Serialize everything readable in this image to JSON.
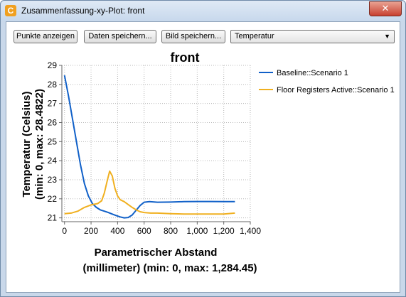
{
  "window": {
    "title": "Zusammenfassung-xy-Plot: front",
    "app_icon_glyph": "C",
    "close_glyph": "✕"
  },
  "toolbar": {
    "show_points_label": "Punkte anzeigen",
    "save_data_label": "Daten speichern...",
    "save_image_label": "Bild speichern...",
    "variable_select": {
      "selected": "Temperatur",
      "arrow_glyph": "▼"
    }
  },
  "chart_data": {
    "type": "line",
    "title": "front",
    "xlabel_line1": "Parametrischer Abstand",
    "xlabel_line2": "(millimeter) (min: 0, max: 1,284.45)",
    "ylabel_line1": "Temperatur (Celsius)",
    "ylabel_line2": "(min: 0, max: 28.4822)",
    "xlim": [
      -20,
      1400
    ],
    "ylim": [
      20.8,
      29
    ],
    "xticks": [
      0,
      200,
      400,
      600,
      800,
      1000,
      1200,
      1400
    ],
    "xtick_labels": [
      "0",
      "200",
      "400",
      "600",
      "800",
      "1,000",
      "1,200",
      "1,400"
    ],
    "yticks": [
      21,
      22,
      23,
      24,
      25,
      26,
      27,
      28,
      29
    ],
    "ytick_labels": [
      "21",
      "22",
      "23",
      "24",
      "25",
      "26",
      "27",
      "28",
      "29"
    ],
    "grid": true,
    "legend_position": "right",
    "series": [
      {
        "name": "Baseline::Scenario 1",
        "color": "#1060c8",
        "x": [
          0,
          30,
          60,
          90,
          120,
          150,
          180,
          210,
          240,
          270,
          300,
          330,
          360,
          390,
          420,
          450,
          480,
          510,
          540,
          570,
          600,
          640,
          700,
          800,
          900,
          1000,
          1100,
          1200,
          1284
        ],
        "y": [
          28.48,
          27.4,
          26.2,
          25.0,
          23.8,
          22.8,
          22.15,
          21.75,
          21.55,
          21.42,
          21.35,
          21.28,
          21.2,
          21.12,
          21.05,
          21.0,
          21.02,
          21.15,
          21.4,
          21.65,
          21.82,
          21.85,
          21.82,
          21.83,
          21.85,
          21.86,
          21.86,
          21.85,
          21.85
        ]
      },
      {
        "name": "Floor Registers Active::Scenario 1",
        "color": "#f0b020",
        "x": [
          0,
          50,
          100,
          150,
          200,
          250,
          280,
          300,
          320,
          340,
          360,
          380,
          400,
          420,
          450,
          480,
          510,
          540,
          570,
          600,
          650,
          700,
          800,
          900,
          1000,
          1100,
          1200,
          1284
        ],
        "y": [
          21.22,
          21.25,
          21.35,
          21.55,
          21.68,
          21.75,
          21.9,
          22.3,
          22.9,
          23.45,
          23.2,
          22.55,
          22.15,
          21.95,
          21.85,
          21.7,
          21.55,
          21.42,
          21.32,
          21.28,
          21.25,
          21.25,
          21.22,
          21.2,
          21.2,
          21.2,
          21.2,
          21.25
        ]
      }
    ]
  }
}
